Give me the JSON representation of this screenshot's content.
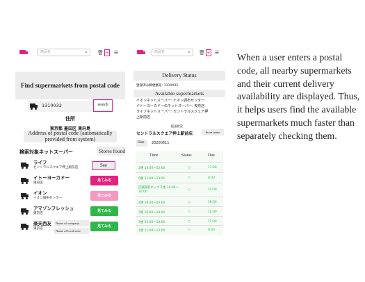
{
  "phone1": {
    "search_placeholder": "商品名",
    "search_icon": "magnifier",
    "trash_icon": "trash",
    "plus_icon": "plus-boxed",
    "list_icon": "list",
    "heading": "Find supermarkets from postal code",
    "postal_input": "1310032",
    "search_button": "search",
    "address_label": "住所",
    "address_value": "東京都 墨田区 東向島",
    "address_note": "Address of postal code (automatically provided from system)",
    "list_title": "検索対象ネットスーパー",
    "stores_found": "Stores found",
    "stores": [
      {
        "name": "ライフ",
        "branch": "セントラルスクエア押上駅前店",
        "button": "See",
        "style": "see"
      },
      {
        "name": "イトーヨーカドー",
        "branch": "曳舟店",
        "button": "見てみる",
        "style": "pink"
      },
      {
        "name": "イオン",
        "branch": "イオン調布センター",
        "button": "見てみる",
        "style": "lpink"
      },
      {
        "name": "アマゾンフレッシュ",
        "branch": "東京店",
        "button": "見てみる",
        "style": "green"
      },
      {
        "name": "楽天西友",
        "branch": "東京店",
        "button": "見てみる",
        "style": "green"
      }
    ],
    "name_of_company": "Name of company",
    "name_of_local_store": "Name of local store"
  },
  "phone2": {
    "search_placeholder": "商品名",
    "status_title": "Delivery Status",
    "registered_postal": "登録済み郵便番号: 1310032",
    "available_title": "Available supermarkets",
    "available_lines": [
      "イオンネットスーパー: イオン調布センター",
      "イトーヨーカドーのネットスーパー: 曳舟店",
      "ライフネットスーパー: セントラルスクエア押",
      "上駅前店"
    ],
    "selected_small": "配送状況",
    "selected_store": "セントラルスクエア押上駅前店",
    "store_name_tag": "Store name",
    "date_label": "Date",
    "date_value": "20200611",
    "col_time": "Time",
    "col_status": "Status",
    "col_due": "Due",
    "rows": [
      {
        "time": "2便 13:00〜15:00",
        "status": "○",
        "due": "11:00"
      },
      {
        "time": "6便 11:00〜13:01",
        "status": "○",
        "due": "8:30"
      },
      {
        "time": "店舗受取ボックス便 16:00〜20:00",
        "status": "○",
        "due": "14:00"
      },
      {
        "time": "4便 18:00〜20:00",
        "status": "○",
        "due": "16:00"
      },
      {
        "time": "7便 16:00〜18:00",
        "status": "○",
        "due": "14:00"
      },
      {
        "time": "3便 15:00〜18:00",
        "status": "○",
        "due": "12:00"
      },
      {
        "time": "1便 11:00〜13:00",
        "status": "○",
        "due": "9:00"
      }
    ]
  },
  "description": "When a user enters a postal code, all nearby supermarkets and their current delivery availability are displayed. Thus, it helps users find the available supermarkets much faster than separately checking them.",
  "colors": {
    "accent_pink": "#e2237f",
    "light_pink": "#f49ac1",
    "green": "#2eb84a"
  }
}
